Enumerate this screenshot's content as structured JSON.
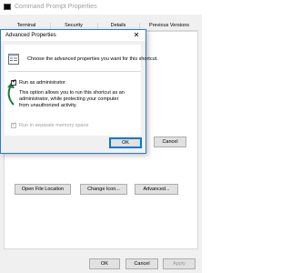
{
  "parent_window": {
    "title": "Command Prompt Properties",
    "tabs": [
      "Terminal",
      "Security",
      "Details",
      "Previous Versions"
    ],
    "buttons": {
      "open_file_location": "Open File Location",
      "change_icon": "Change Icon...",
      "advanced": "Advanced...",
      "ok": "OK",
      "cancel": "Cancel",
      "apply": "Apply"
    }
  },
  "dialog": {
    "title": "Advanced Properties",
    "close_glyph": "✕",
    "prompt": "Choose the advanced properties you want for this shortcut.",
    "run_as_admin": {
      "label": "Run as administrator",
      "checked": true,
      "description": "This option allows you to run this shortcut as an administrator, while protecting your computer from unauthorized activity."
    },
    "separate_memory": {
      "label": "Run in separate memory space",
      "checked": true,
      "enabled": false
    },
    "buttons": {
      "ok": "OK",
      "cancel": "Cancel"
    }
  },
  "icons": [
    "properties-icon",
    "check-icon",
    "close-icon",
    "green-arrow-icon",
    "cmd-icon"
  ],
  "colors": {
    "accent": "#0078d7",
    "dialog_border": "#2b79d0",
    "arrow": "#1f7a3a"
  }
}
